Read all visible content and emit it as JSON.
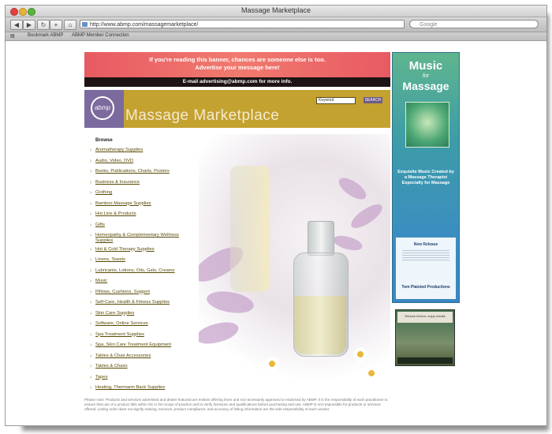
{
  "window": {
    "title": "Massage Marketplace",
    "url": "http://www.abmp.com/massagemarketplace/",
    "search_placeholder": "Google",
    "bookmarks": [
      "Bookmark ABMP",
      "ABMP Member Connection"
    ]
  },
  "banner": {
    "line1": "If you're reading this banner, chances are someone else is too.",
    "line2": "Advertise your message here!",
    "line3": "E-mail advertising@abmp.com for more info."
  },
  "header": {
    "logo_text": "abmp",
    "title": "Massage Marketplace",
    "search_value": "Keyword",
    "search_button": "SEARCH"
  },
  "browse": {
    "title": "Browse",
    "categories": [
      "Aromatherapy Supplies",
      "Audio, Video, DVD",
      "Books, Publications, Charts, Posters",
      "Business & Insurance",
      "Clothing",
      "Bamboo Massage Supplies",
      "Hot Line & Products",
      "Gifts",
      "Homeopathy & Complementary Wellness Supplies",
      "Hot & Cold Therapy Supplies",
      "Linens, Towels",
      "Lubricants, Lotions, Oils, Gels, Creams",
      "Music",
      "Pillows, Cushions, Support",
      "Self-Care, Health & Fitness Supplies",
      "Skin Care Supplies",
      "Software, Online Services",
      "Spa Treatment Supplies",
      "Spa, Skin Care Treatment Equipment",
      "Tables & Chair Accessories",
      "Tables & Chairs",
      "Tapes",
      "Heating, Thermarm Back Supplies"
    ]
  },
  "ad_music": {
    "title1": "Music",
    "title2": "for",
    "title3": "Massage",
    "body": "Exquisite Music Created by a Massage Therapist Especially for Massage",
    "white_title": "New Release",
    "white_footer": "Tom Plaisted Productions"
  },
  "ad_small": {
    "text": "Reduce friction, enjoy results"
  },
  "footer": {
    "text": "Please note: Products and services advertised and dealer featured are entities offering them and not necessarily approved or endorsed by ABMP. It is the responsibility of each practitioner to ensure that use of a product falls within his or her scope of practice and to verify licensure and qualifications before purchasing and use. ABMP is not responsible for products or services offered. Listing order does not signify ranking; services, product compliance, and accuracy of listing information are the sole responsibility of each vendor."
  }
}
